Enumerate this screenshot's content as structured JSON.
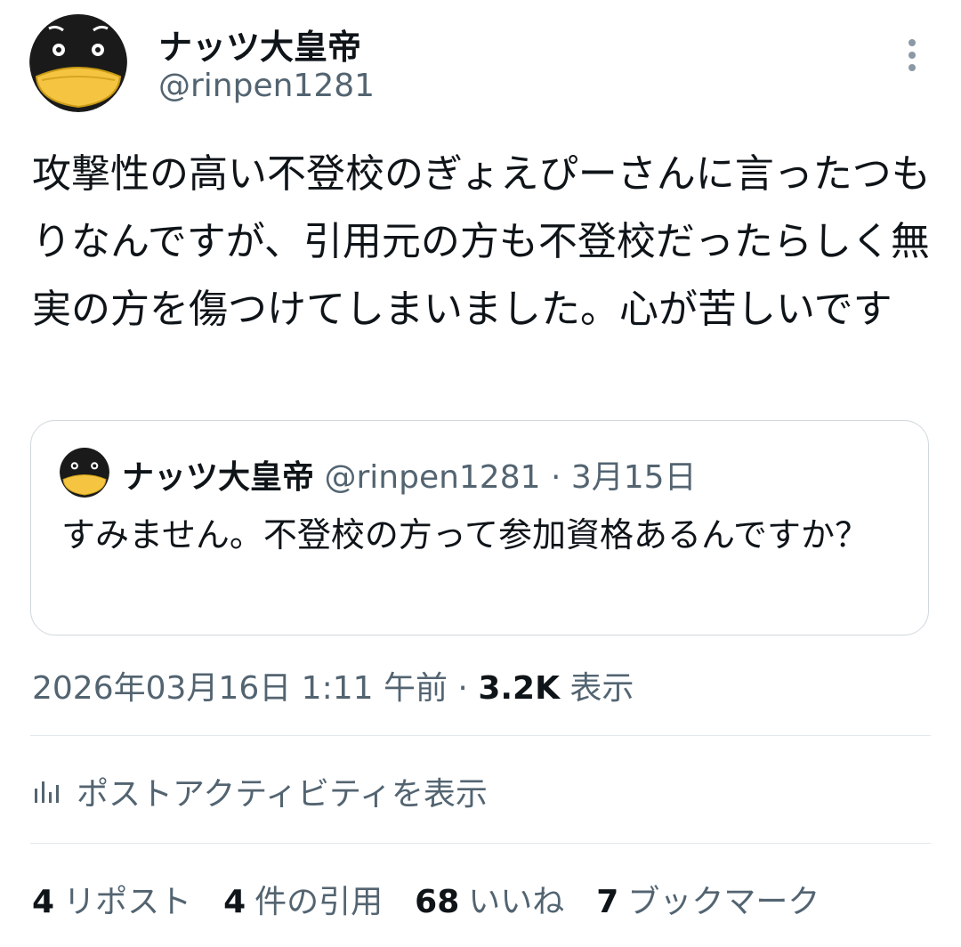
{
  "author": {
    "name": "ナッツ大皇帝",
    "handle": "@rinpen1281"
  },
  "tweet": {
    "text": "攻撃性の高い不登校のぎょえぴーさんに言ったつもりなんですが、引用元の方も不登校だったらしく無実の方を傷つけてしまいました。心が苦しいです"
  },
  "quoted": {
    "name": "ナッツ大皇帝",
    "handle": "@rinpen1281",
    "separator": " · ",
    "date": "3月15日",
    "text": "すみません。不登校の方って参加資格あるんですか？"
  },
  "meta": {
    "timestamp": "2026年03月16日 1:11 午前",
    "separator": " · ",
    "views_count": "3.2K",
    "views_label": " 表示"
  },
  "activity": {
    "label": "ポストアクティビティを表示"
  },
  "stats": [
    {
      "count": "4",
      "label": "リポスト"
    },
    {
      "count": "4",
      "label": "件の引用"
    },
    {
      "count": "68",
      "label": "いいね"
    },
    {
      "count": "7",
      "label": "ブックマーク"
    }
  ],
  "colors": {
    "text_primary": "#0f1419",
    "text_secondary": "#536471",
    "border": "#cfd9de"
  }
}
